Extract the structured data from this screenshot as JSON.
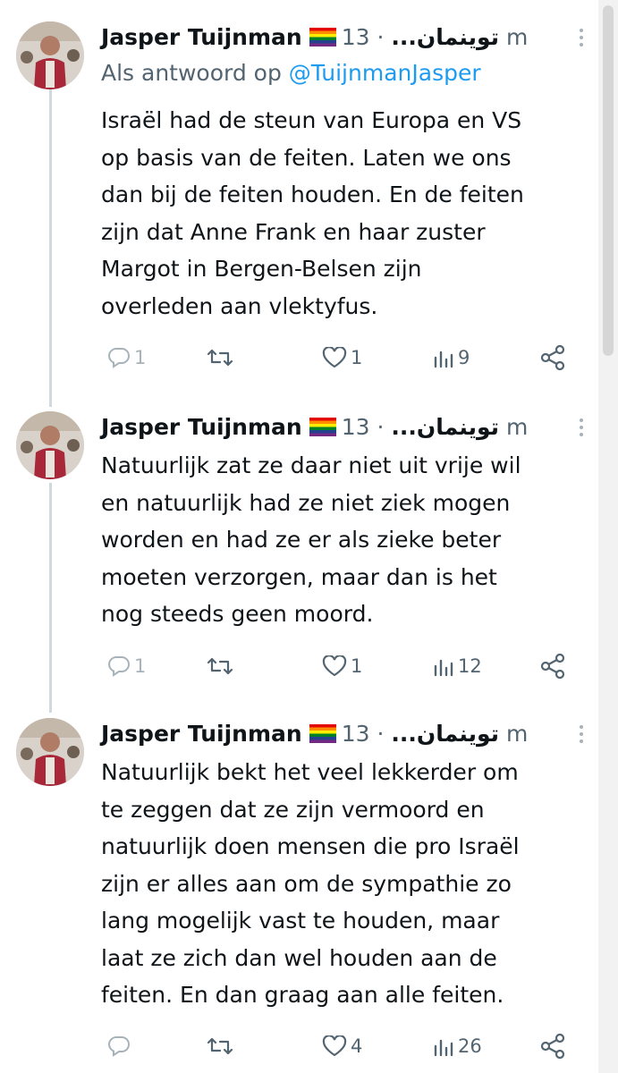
{
  "tweets": [
    {
      "author": "Jasper Tuijnman",
      "flag": "rainbow-flag",
      "arabic_name": "توينمان",
      "ellipsis": "...",
      "time": "· 13 m",
      "reply_prefix": "Als antwoord op",
      "reply_handle": "@TuijnmanJasper",
      "lines": [
        "Israël had de steun van Europa en VS",
        "op basis van de feiten. Laten we ons",
        "dan bij de feiten houden. En de feiten",
        "zijn dat Anne Frank en haar zuster",
        "Margot in Bergen-Belsen zijn",
        "overleden aan vlektyfus."
      ],
      "replies": "1",
      "retweets": "",
      "likes": "1",
      "views": "9"
    },
    {
      "author": "Jasper Tuijnman",
      "flag": "rainbow-flag",
      "arabic_name": "توينمان",
      "ellipsis": "...",
      "time": "· 13 m",
      "lines": [
        "Natuurlijk zat ze daar niet uit vrije wil",
        "en natuurlijk had ze niet ziek mogen",
        "worden en had ze er als zieke beter",
        "moeten verzorgen, maar dan is het",
        "nog steeds geen moord."
      ],
      "replies": "1",
      "retweets": "",
      "likes": "1",
      "views": "12"
    },
    {
      "author": "Jasper Tuijnman",
      "flag": "rainbow-flag",
      "arabic_name": "توينمان",
      "ellipsis": "...",
      "time": "· 13 m",
      "lines": [
        "Natuurlijk bekt het veel lekkerder om",
        "te zeggen dat ze zijn vermoord en",
        "natuurlijk doen mensen die pro Israël",
        "zijn er alles aan om de sympathie zo",
        "lang mogelijk vast te houden, maar",
        "laat ze zich dan wel houden aan de",
        "feiten. En dan graag aan alle feiten."
      ],
      "replies": "",
      "retweets": "",
      "likes": "4",
      "views": "26"
    }
  ],
  "colors": {
    "text": "#0f1419",
    "muted": "#536471",
    "link": "#1d9bf0",
    "thread_line": "#cfd9de"
  },
  "icons": [
    "reply-icon",
    "retweet-icon",
    "like-icon",
    "views-icon",
    "share-icon",
    "more-icon",
    "rainbow-flag-icon"
  ]
}
